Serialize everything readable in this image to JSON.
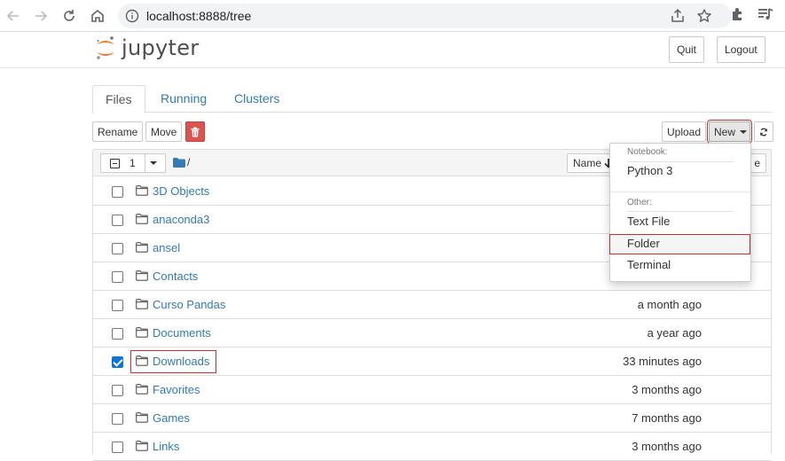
{
  "browser": {
    "url": "localhost:8888/tree"
  },
  "header": {
    "logo_text": "jupyter",
    "quit_label": "Quit",
    "logout_label": "Logout"
  },
  "tabs": [
    {
      "label": "Files",
      "active": true
    },
    {
      "label": "Running",
      "active": false
    },
    {
      "label": "Clusters",
      "active": false
    }
  ],
  "toolbar": {
    "rename_label": "Rename",
    "move_label": "Move",
    "upload_label": "Upload",
    "new_label": "New"
  },
  "list_header": {
    "selected_count": "1",
    "breadcrumb": "/",
    "name_label": "Name",
    "size_label_fragment": "e"
  },
  "files": [
    {
      "name": "3D Objects",
      "modified": "",
      "checked": false
    },
    {
      "name": "anaconda3",
      "modified": "",
      "checked": false
    },
    {
      "name": "ansel",
      "modified": "",
      "checked": false
    },
    {
      "name": "Contacts",
      "modified": "",
      "checked": false
    },
    {
      "name": "Curso Pandas",
      "modified": "a month ago",
      "checked": false
    },
    {
      "name": "Documents",
      "modified": "a year ago",
      "checked": false
    },
    {
      "name": "Downloads",
      "modified": "33 minutes ago",
      "checked": true
    },
    {
      "name": "Favorites",
      "modified": "3 months ago",
      "checked": false
    },
    {
      "name": "Games",
      "modified": "7 months ago",
      "checked": false
    },
    {
      "name": "Links",
      "modified": "3 months ago",
      "checked": false
    }
  ],
  "new_menu": {
    "notebook_header": "Notebook:",
    "python_label": "Python 3",
    "other_header": "Other:",
    "text_file_label": "Text File",
    "folder_label": "Folder",
    "terminal_label": "Terminal"
  },
  "colors": {
    "link": "#337ab7",
    "danger": "#d9534f",
    "highlight_outline": "#c9302c",
    "logo_orange": "#f37726"
  }
}
